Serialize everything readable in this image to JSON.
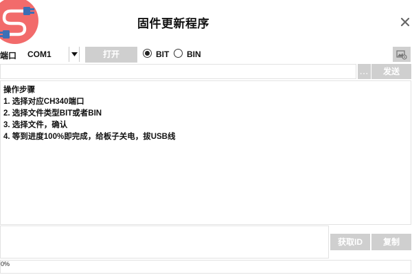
{
  "window": {
    "title": "固件更新程序",
    "logo_icon": "usb-cable-icon",
    "close_icon": "close-icon"
  },
  "toolbar": {
    "port_label": "端口",
    "port_value": "COM1",
    "open_label": "打开",
    "format_options": [
      {
        "label": "BIT",
        "checked": true
      },
      {
        "label": "BIN",
        "checked": false
      }
    ],
    "settings_icon": "image-settings-icon"
  },
  "send_row": {
    "input_value": "",
    "browse_label": "...",
    "send_label": "发送"
  },
  "instructions": {
    "lines": [
      "操作步骤",
      "1. 选择对应CH340端口",
      "2. 选择文件类型BIT或者BIN",
      "3. 选择文件，确认",
      "4. 等到进度100%即完成，给板子关电，拔USB线"
    ]
  },
  "id_panel": {
    "value": "",
    "get_id_label": "获取ID",
    "copy_label": "复制"
  },
  "progress": {
    "value": 0,
    "text": "0%"
  },
  "colors": {
    "accent_logo": "#f26b6b",
    "button_gray": "#cfcfcf",
    "border": "#e2e2e2"
  }
}
